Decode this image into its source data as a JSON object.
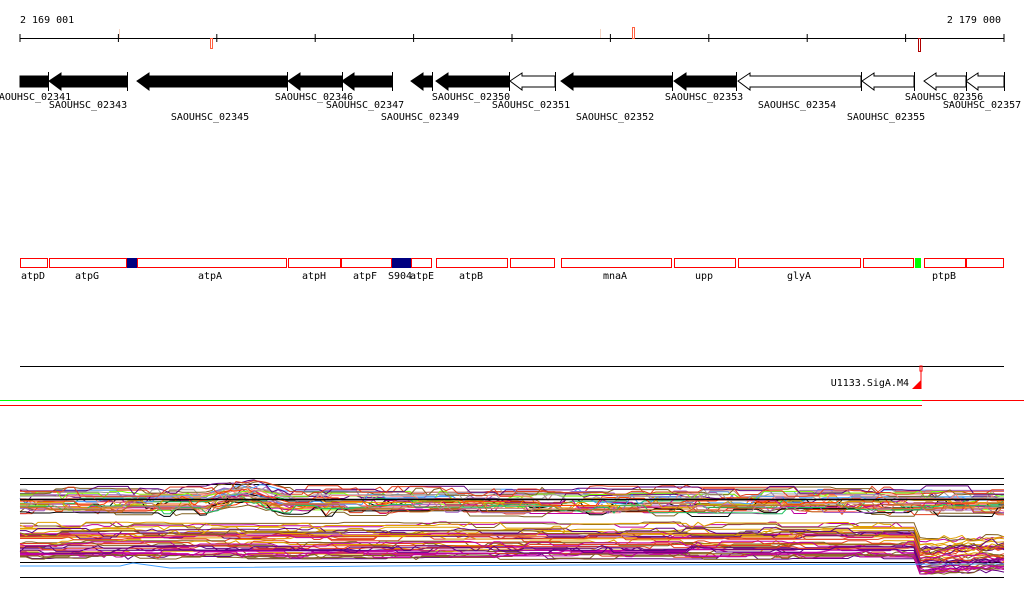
{
  "ruler": {
    "start_label": "2 169 001",
    "end_label": "2 179 000"
  },
  "genes": [
    {
      "label": "AOUHSC_02341",
      "fill": "#000000"
    },
    {
      "label": "SAOUHSC_02343",
      "fill": "#000000"
    },
    {
      "label": "SAOUHSC_02345",
      "fill": "#000000"
    },
    {
      "label": "SAOUHSC_02346",
      "fill": "#000000"
    },
    {
      "label": "SAOUHSC_02347",
      "fill": "#000000"
    },
    {
      "label": "SAOUHSC_02349",
      "fill": "#000000"
    },
    {
      "label": "SAOUHSC_02350",
      "fill": "#000000"
    },
    {
      "label": "SAOUHSC_02351",
      "fill": "#ffffff"
    },
    {
      "label": "SAOUHSC_02352",
      "fill": "#000000"
    },
    {
      "label": "SAOUHSC_02353",
      "fill": "#000000"
    },
    {
      "label": "SAOUHSC_02354",
      "fill": "#ffffff"
    },
    {
      "label": "SAOUHSC_02355",
      "fill": "#ffffff"
    },
    {
      "label": "SAOUHSC_02356",
      "fill": "#ffffff"
    },
    {
      "label": "SAOUHSC_02357",
      "fill": "#ffffff"
    }
  ],
  "annotations": [
    {
      "label": "atpD",
      "color": "#ff0000"
    },
    {
      "label": "atpG",
      "color": "#ff0000"
    },
    {
      "label": "",
      "color": "#000080"
    },
    {
      "label": "atpA",
      "color": "#ff0000"
    },
    {
      "label": "atpH",
      "color": "#ff0000"
    },
    {
      "label": "atpF",
      "color": "#ff0000"
    },
    {
      "label": "S904",
      "color": "#000080"
    },
    {
      "label": "atpE",
      "color": "#ff0000"
    },
    {
      "label": "atpB",
      "color": "#ff0000"
    },
    {
      "label": "",
      "color": "#ff0000"
    },
    {
      "label": "mnaA",
      "color": "#ff0000"
    },
    {
      "label": "upp",
      "color": "#ff0000"
    },
    {
      "label": "glyA",
      "color": "#ff0000"
    },
    {
      "label": "",
      "color": "#ff0000"
    },
    {
      "label": "",
      "color": "#00ff00"
    },
    {
      "label": "ptpB",
      "color": "#ff0000"
    },
    {
      "label": "",
      "color": "#ff0000"
    }
  ],
  "promoter": {
    "label": "U1133.SigA.M4",
    "color": "#ff0000"
  },
  "colors": {
    "accent_red": "#ff0000",
    "green": "#00ff00"
  }
}
